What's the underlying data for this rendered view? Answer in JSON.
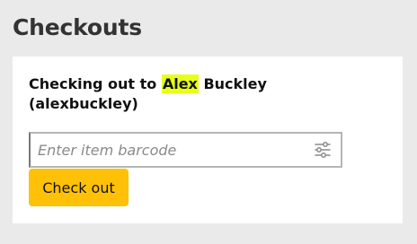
{
  "page": {
    "title": "Checkouts"
  },
  "checkout": {
    "heading_prefix": "Checking out to ",
    "patron_first_name": "Alex",
    "patron_last_name_suffix": " Buckley",
    "patron_username": "(alexbuckley)",
    "barcode_placeholder": "Enter item barcode",
    "barcode_value": "",
    "settings_icon": "sliders-icon",
    "highlight_color": "#e8ff1a",
    "submit_label": "Check out",
    "submit_color": "#ffc107"
  }
}
